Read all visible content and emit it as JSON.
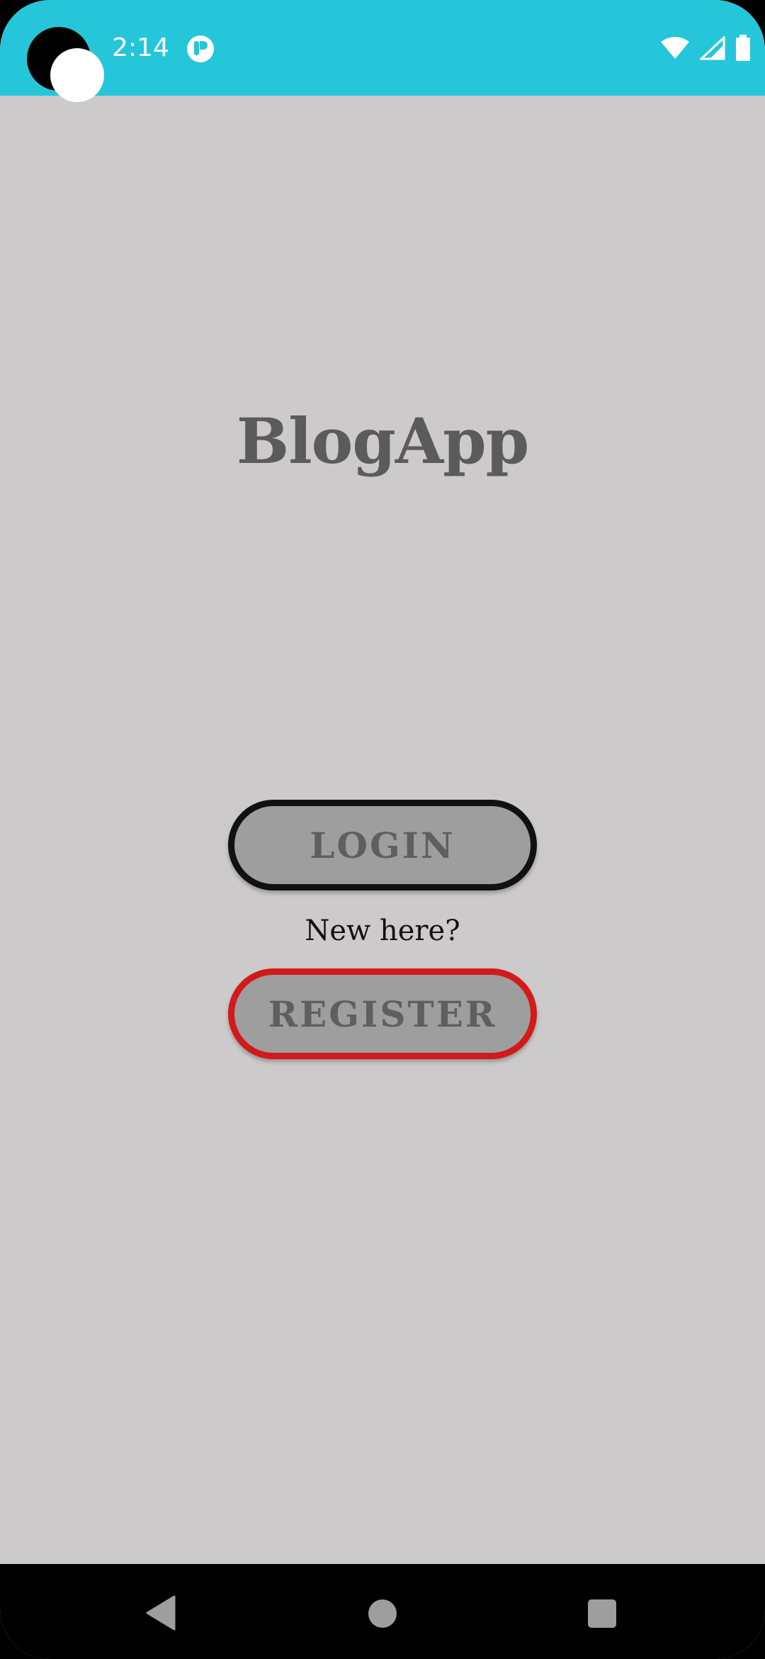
{
  "status_bar": {
    "time": "2:14",
    "background_color": "#26c6da",
    "icons": [
      "app-notification-icon",
      "wifi-icon",
      "signal-icon",
      "battery-icon"
    ]
  },
  "main": {
    "app_title": "BlogApp",
    "login_label": "LOGIN",
    "new_here_text": "New here?",
    "register_label": "REGISTER",
    "background_color": "#cccacb",
    "button_fill_color": "#9e9e9e",
    "login_border_color": "#111111",
    "register_border_color": "#d21a1a"
  },
  "nav_bar": {
    "icons": [
      "back-icon",
      "home-icon",
      "recents-icon"
    ]
  }
}
